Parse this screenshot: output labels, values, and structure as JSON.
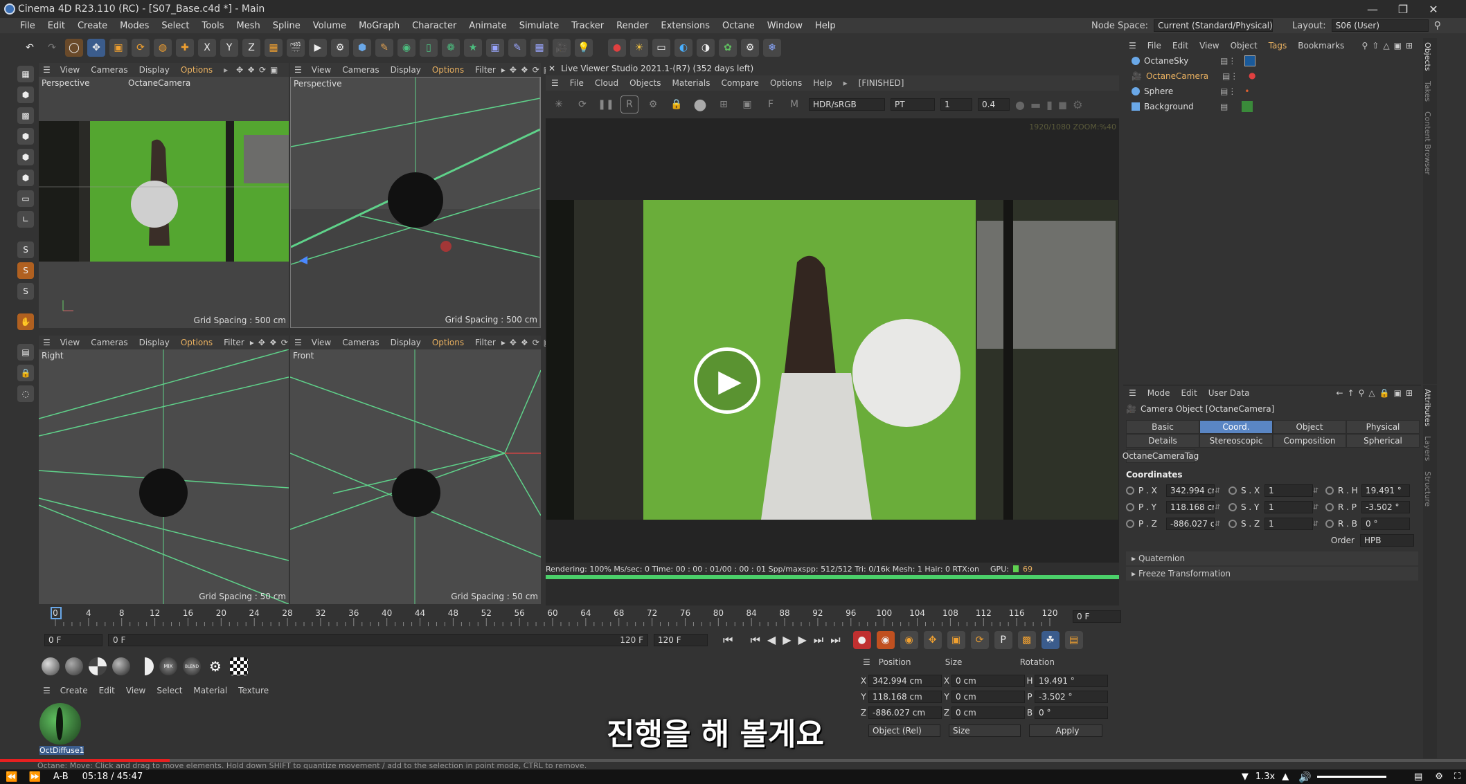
{
  "window": {
    "title": "Cinema 4D R23.110 (RC) - [S07_Base.c4d *] - Main"
  },
  "menu": [
    "File",
    "Edit",
    "Create",
    "Modes",
    "Select",
    "Tools",
    "Mesh",
    "Spline",
    "Volume",
    "MoGraph",
    "Character",
    "Animate",
    "Simulate",
    "Tracker",
    "Render",
    "Extensions",
    "Octane",
    "Window",
    "Help"
  ],
  "node_space": {
    "label": "Node Space:",
    "value": "Current (Standard/Physical)"
  },
  "layout": {
    "label": "Layout:",
    "value": "S06 (User)"
  },
  "viewport_menu": [
    "View",
    "Cameras",
    "Display",
    "Options",
    "Filter"
  ],
  "viewports": {
    "tl": {
      "name": "Perspective",
      "camera": "OctaneCamera"
    },
    "tr": {
      "name": "Perspective",
      "grid": "Grid Spacing : 500 cm"
    },
    "bl": {
      "name": "Right",
      "grid": "Grid Spacing : 50 cm"
    },
    "br": {
      "name": "Front",
      "grid": "Grid Spacing : 50 cm"
    },
    "tl_grid": "Grid Spacing : 500 cm"
  },
  "live_viewer": {
    "title": "Live Viewer Studio 2021.1-(R7) (352 days left)",
    "menu": [
      "File",
      "Cloud",
      "Objects",
      "Materials",
      "Compare",
      "Options",
      "Help"
    ],
    "status": "[FINISHED]",
    "color_mode": "HDR/sRGB",
    "kernel": "PT",
    "val1": "1",
    "val2": "0.4",
    "resolution_overlay": "1920/1080 ZOOM:%40",
    "render_status": "Rendering: 100% Ms/sec: 0   Time: 00 : 00 : 01/00 : 00 : 01   Spp/maxspp: 512/512   Tri: 0/16k   Mesh: 1 Hair: 0   RTX:on",
    "gpu_label": "GPU:",
    "gpu_value": "69"
  },
  "objects_panel": {
    "menu": [
      "File",
      "Edit",
      "View",
      "Object",
      "Tags",
      "Bookmarks"
    ],
    "items": [
      {
        "name": "OctaneSky",
        "highlight": false
      },
      {
        "name": "OctaneCamera",
        "highlight": true
      },
      {
        "name": "Sphere",
        "highlight": false
      },
      {
        "name": "Background",
        "highlight": false
      }
    ]
  },
  "side_tabs_right": [
    "Objects",
    "Takes",
    "Content Browser"
  ],
  "side_tabs_right2": [
    "Attributes",
    "Layers",
    "Structure"
  ],
  "attributes": {
    "menu": [
      "Mode",
      "Edit",
      "User Data"
    ],
    "object_title": "Camera Object [OctaneCamera]",
    "tabs_row1": [
      "Basic",
      "Coord.",
      "Object",
      "Physical"
    ],
    "tabs_row2": [
      "Details",
      "Stereoscopic",
      "Composition",
      "Spherical"
    ],
    "tag_tab": "OctaneCameraTag",
    "section": "Coordinates",
    "rows": [
      {
        "p_label": "P . X",
        "p": "342.994 cm",
        "s_label": "S . X",
        "s": "1",
        "r_label": "R . H",
        "r": "19.491 °"
      },
      {
        "p_label": "P . Y",
        "p": "118.168 cm",
        "s_label": "S . Y",
        "s": "1",
        "r_label": "R . P",
        "r": "-3.502 °"
      },
      {
        "p_label": "P . Z",
        "p": "-886.027 cr",
        "s_label": "S . Z",
        "s": "1",
        "r_label": "R . B",
        "r": "0 °"
      }
    ],
    "order_label": "Order",
    "order_value": "HPB",
    "quaternion": "Quaternion",
    "freeze": "Freeze Transformation"
  },
  "timeline": {
    "ticks": [
      "0",
      "4",
      "8",
      "12",
      "16",
      "20",
      "24",
      "28",
      "32",
      "36",
      "40",
      "44",
      "48",
      "52",
      "56",
      "60",
      "64",
      "68",
      "72",
      "76",
      "80",
      "84",
      "88",
      "92",
      "96",
      "100",
      "104",
      "108",
      "112",
      "116",
      "120"
    ],
    "current": "0 F",
    "start": "0 F",
    "range_start": "0 F",
    "range_end": "120 F",
    "end": "120 F"
  },
  "material_manager": {
    "menu": [
      "Create",
      "Edit",
      "View",
      "Select",
      "Material",
      "Texture"
    ],
    "material": "OctDiffuse1"
  },
  "coord_manager": {
    "headers": [
      "Position",
      "Size",
      "Rotation"
    ],
    "rows": [
      {
        "a": "X",
        "pos": "342.994 cm",
        "b": "X",
        "size": "0 cm",
        "c": "H",
        "rot": "19.491 °"
      },
      {
        "a": "Y",
        "pos": "118.168 cm",
        "b": "Y",
        "size": "0 cm",
        "c": "P",
        "rot": "-3.502 °"
      },
      {
        "a": "Z",
        "pos": "-886.027 cm",
        "b": "Z",
        "size": "0 cm",
        "c": "B",
        "rot": "0 °"
      }
    ],
    "mode": "Object (Rel)",
    "size_mode": "Size",
    "apply": "Apply"
  },
  "status_bar": "Octane:    Move: Click and drag to move elements. Hold down SHIFT to quantize movement / add to the selection in point mode, CTRL to remove.",
  "subtitle": "진행을 해 볼게요",
  "player": {
    "ab": "A-B",
    "time": "05:18 / 45:47",
    "speed": "1.3x",
    "progress": 0.1159
  }
}
